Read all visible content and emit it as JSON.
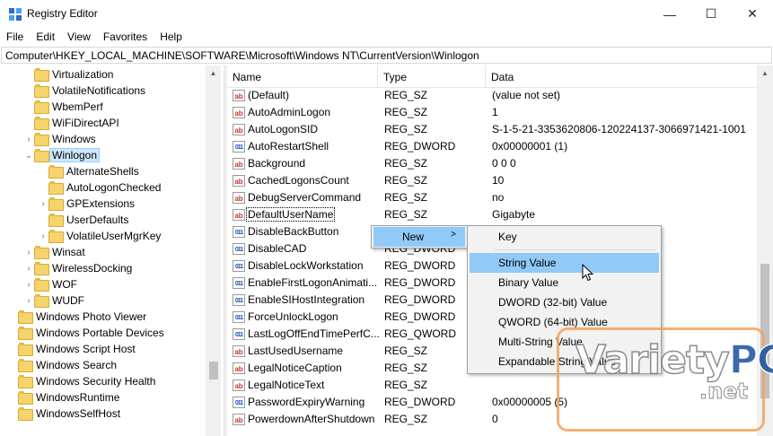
{
  "window": {
    "title": "Registry Editor",
    "minimize_glyph": "—",
    "maximize_glyph": "☐",
    "close_glyph": "✕"
  },
  "menu": [
    "File",
    "Edit",
    "View",
    "Favorites",
    "Help"
  ],
  "address": "Computer\\HKEY_LOCAL_MACHINE\\SOFTWARE\\Microsoft\\Windows NT\\CurrentVersion\\Winlogon",
  "tree": [
    {
      "label": "Virtualization",
      "level": 2,
      "expander": ""
    },
    {
      "label": "VolatileNotifications",
      "level": 2,
      "expander": ""
    },
    {
      "label": "WbemPerf",
      "level": 2,
      "expander": ""
    },
    {
      "label": "WiFiDirectAPI",
      "level": 2,
      "expander": ""
    },
    {
      "label": "Windows",
      "level": 2,
      "expander": ">"
    },
    {
      "label": "Winlogon",
      "level": 2,
      "expander": "v",
      "selected": true
    },
    {
      "label": "AlternateShells",
      "level": 3,
      "expander": ""
    },
    {
      "label": "AutoLogonChecked",
      "level": 3,
      "expander": ""
    },
    {
      "label": "GPExtensions",
      "level": 3,
      "expander": ">"
    },
    {
      "label": "UserDefaults",
      "level": 3,
      "expander": ""
    },
    {
      "label": "VolatileUserMgrKey",
      "level": 3,
      "expander": ">"
    },
    {
      "label": "Winsat",
      "level": 2,
      "expander": ">"
    },
    {
      "label": "WirelessDocking",
      "level": 2,
      "expander": ">"
    },
    {
      "label": "WOF",
      "level": 2,
      "expander": ">"
    },
    {
      "label": "WUDF",
      "level": 2,
      "expander": ">"
    },
    {
      "label": "Windows Photo Viewer",
      "level": 0,
      "expander": ""
    },
    {
      "label": "Windows Portable Devices",
      "level": 0,
      "expander": ""
    },
    {
      "label": "Windows Script Host",
      "level": 0,
      "expander": ""
    },
    {
      "label": "Windows Search",
      "level": 0,
      "expander": ""
    },
    {
      "label": "Windows Security Health",
      "level": 0,
      "expander": ""
    },
    {
      "label": "WindowsRuntime",
      "level": 0,
      "expander": ""
    },
    {
      "label": "WindowsSelfHost",
      "level": 0,
      "expander": ""
    }
  ],
  "columns": {
    "name": "Name",
    "type": "Type",
    "data": "Data"
  },
  "values": [
    {
      "icon": "ab",
      "name": "(Default)",
      "type": "REG_SZ",
      "data": "(value not set)"
    },
    {
      "icon": "ab",
      "name": "AutoAdminLogon",
      "type": "REG_SZ",
      "data": "1"
    },
    {
      "icon": "ab",
      "name": "AutoLogonSID",
      "type": "REG_SZ",
      "data": "S-1-5-21-3353620806-120224137-3066971421-1001"
    },
    {
      "icon": "bin",
      "name": "AutoRestartShell",
      "type": "REG_DWORD",
      "data": "0x00000001 (1)"
    },
    {
      "icon": "ab",
      "name": "Background",
      "type": "REG_SZ",
      "data": "0 0 0"
    },
    {
      "icon": "ab",
      "name": "CachedLogonsCount",
      "type": "REG_SZ",
      "data": "10"
    },
    {
      "icon": "ab",
      "name": "DebugServerCommand",
      "type": "REG_SZ",
      "data": "no"
    },
    {
      "icon": "ab",
      "name": "DefaultUserName",
      "type": "REG_SZ",
      "data": "Gigabyte",
      "focused": true
    },
    {
      "icon": "bin",
      "name": "DisableBackButton",
      "type": "",
      "data": ""
    },
    {
      "icon": "bin",
      "name": "DisableCAD",
      "type": "REG_DWORD",
      "data": ""
    },
    {
      "icon": "bin",
      "name": "DisableLockWorkstation",
      "type": "REG_DWORD",
      "data": ""
    },
    {
      "icon": "bin",
      "name": "EnableFirstLogonAnimati...",
      "type": "REG_DWORD",
      "data": ""
    },
    {
      "icon": "bin",
      "name": "EnableSIHostIntegration",
      "type": "REG_DWORD",
      "data": ""
    },
    {
      "icon": "bin",
      "name": "ForceUnlockLogon",
      "type": "REG_DWORD",
      "data": ""
    },
    {
      "icon": "bin",
      "name": "LastLogOffEndTimePerfC...",
      "type": "REG_QWORD",
      "data": ""
    },
    {
      "icon": "ab",
      "name": "LastUsedUsername",
      "type": "REG_SZ",
      "data": ""
    },
    {
      "icon": "ab",
      "name": "LegalNoticeCaption",
      "type": "REG_SZ",
      "data": ""
    },
    {
      "icon": "ab",
      "name": "LegalNoticeText",
      "type": "REG_SZ",
      "data": ""
    },
    {
      "icon": "bin",
      "name": "PasswordExpiryWarning",
      "type": "REG_DWORD",
      "data": "0x00000005 (5)"
    },
    {
      "icon": "ab",
      "name": "PowerdownAfterShutdown",
      "type": "REG_SZ",
      "data": "0"
    }
  ],
  "context_menu": {
    "new_label": "New",
    "new_arrow": ">",
    "submenu": [
      {
        "label": "Key"
      },
      {
        "label": "String Value",
        "highlighted": true
      },
      {
        "label": "Binary Value"
      },
      {
        "label": "DWORD (32-bit) Value"
      },
      {
        "label": "QWORD (64-bit) Value"
      },
      {
        "label": "Multi-String Value"
      },
      {
        "label": "Expandable String Value"
      }
    ]
  },
  "watermark": {
    "brand_a": "Variety",
    "brand_b": "PC",
    "suffix": ".net"
  }
}
